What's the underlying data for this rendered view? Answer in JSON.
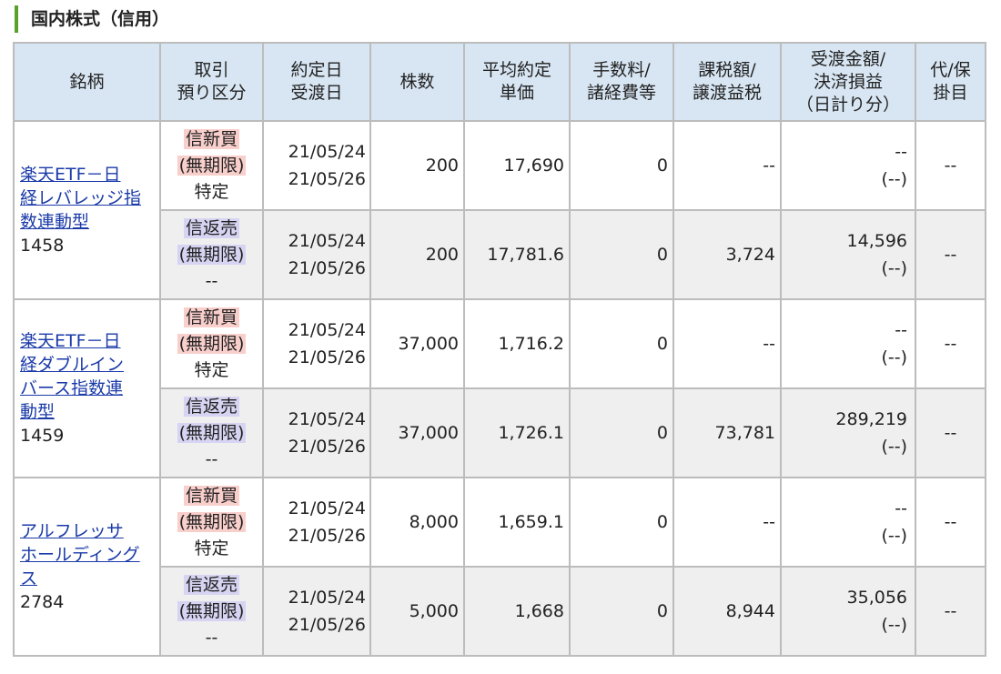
{
  "section": {
    "title": "国内株式（信用）"
  },
  "headers": {
    "name": "銘柄",
    "type_1": "取引",
    "type_2": "預り区分",
    "date_1": "約定日",
    "date_2": "受渡日",
    "qty": "株数",
    "price_1": "平均約定",
    "price_2": "単価",
    "fee_1": "手数料/",
    "fee_2": "諸経費等",
    "tax_1": "課税額/",
    "tax_2": "譲渡益税",
    "pl_1": "受渡金額/",
    "pl_2": "決済損益",
    "pl_3": "（日計り分）",
    "proxy_1": "代/保",
    "proxy_2": "掛目"
  },
  "securities": [
    {
      "name_line1": "楽天ETF－日",
      "name_line2": "経レバレッジ指",
      "name_line3": "数連動型",
      "code": "1458",
      "rows": [
        {
          "trade": "信新買",
          "term": "(無期限)",
          "account": "特定",
          "trade_date": "21/05/24",
          "settle_date": "21/05/26",
          "qty": "200",
          "price": "17,690",
          "fee": "0",
          "tax": "--",
          "amount": "--",
          "daytrade": "(--)",
          "proxy": "--"
        },
        {
          "trade": "信返売",
          "term": "(無期限)",
          "account": "--",
          "trade_date": "21/05/24",
          "settle_date": "21/05/26",
          "qty": "200",
          "price": "17,781.6",
          "fee": "0",
          "tax": "3,724",
          "amount": "14,596",
          "daytrade": "(--)",
          "proxy": "--"
        }
      ]
    },
    {
      "name_line1": "楽天ETF－日",
      "name_line2": "経ダブルイン",
      "name_line3": "バース指数連",
      "name_line4": "動型",
      "code": "1459",
      "rows": [
        {
          "trade": "信新買",
          "term": "(無期限)",
          "account": "特定",
          "trade_date": "21/05/24",
          "settle_date": "21/05/26",
          "qty": "37,000",
          "price": "1,716.2",
          "fee": "0",
          "tax": "--",
          "amount": "--",
          "daytrade": "(--)",
          "proxy": "--"
        },
        {
          "trade": "信返売",
          "term": "(無期限)",
          "account": "--",
          "trade_date": "21/05/24",
          "settle_date": "21/05/26",
          "qty": "37,000",
          "price": "1,726.1",
          "fee": "0",
          "tax": "73,781",
          "amount": "289,219",
          "daytrade": "(--)",
          "proxy": "--"
        }
      ]
    },
    {
      "name_line1": "アルフレッサ",
      "name_line2": "ホールディング",
      "name_line3": "ス",
      "code": "2784",
      "rows": [
        {
          "trade": "信新買",
          "term": "(無期限)",
          "account": "特定",
          "trade_date": "21/05/24",
          "settle_date": "21/05/26",
          "qty": "8,000",
          "price": "1,659.1",
          "fee": "0",
          "tax": "--",
          "amount": "--",
          "daytrade": "(--)",
          "proxy": "--"
        },
        {
          "trade": "信返売",
          "term": "(無期限)",
          "account": "--",
          "trade_date": "21/05/24",
          "settle_date": "21/05/26",
          "qty": "5,000",
          "price": "1,668",
          "fee": "0",
          "tax": "8,944",
          "amount": "35,056",
          "daytrade": "(--)",
          "proxy": "--"
        }
      ]
    }
  ]
}
